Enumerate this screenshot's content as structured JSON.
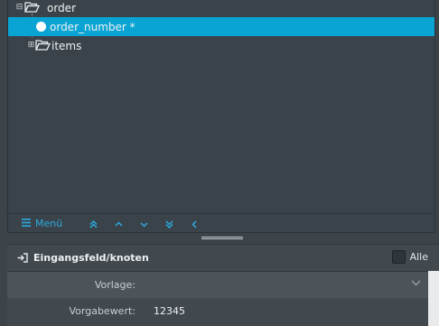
{
  "tree": {
    "nodes": [
      {
        "label": "order",
        "toggle": "⊟"
      },
      {
        "label": "order_number *"
      },
      {
        "label": "items",
        "toggle": "⊞"
      }
    ]
  },
  "toolbar": {
    "menu_label": "Menü",
    "buttons": [
      "⏫",
      "▲",
      "▼",
      "⏬",
      "◀"
    ]
  },
  "detail": {
    "title": "Eingangsfeld/knoten",
    "all_label": "Alle",
    "rows": [
      {
        "label": "Vorlage:",
        "value": ""
      },
      {
        "label": "Vorgabewert:",
        "value": "12345"
      }
    ]
  },
  "colors": {
    "selection": "#0aa4d4",
    "accent": "#2aaae0",
    "panel": "#3b434a"
  },
  "icons": [
    "folder-open-icon",
    "bullet-icon",
    "menu-icon",
    "login-icon",
    "chevron-down-icon"
  ]
}
